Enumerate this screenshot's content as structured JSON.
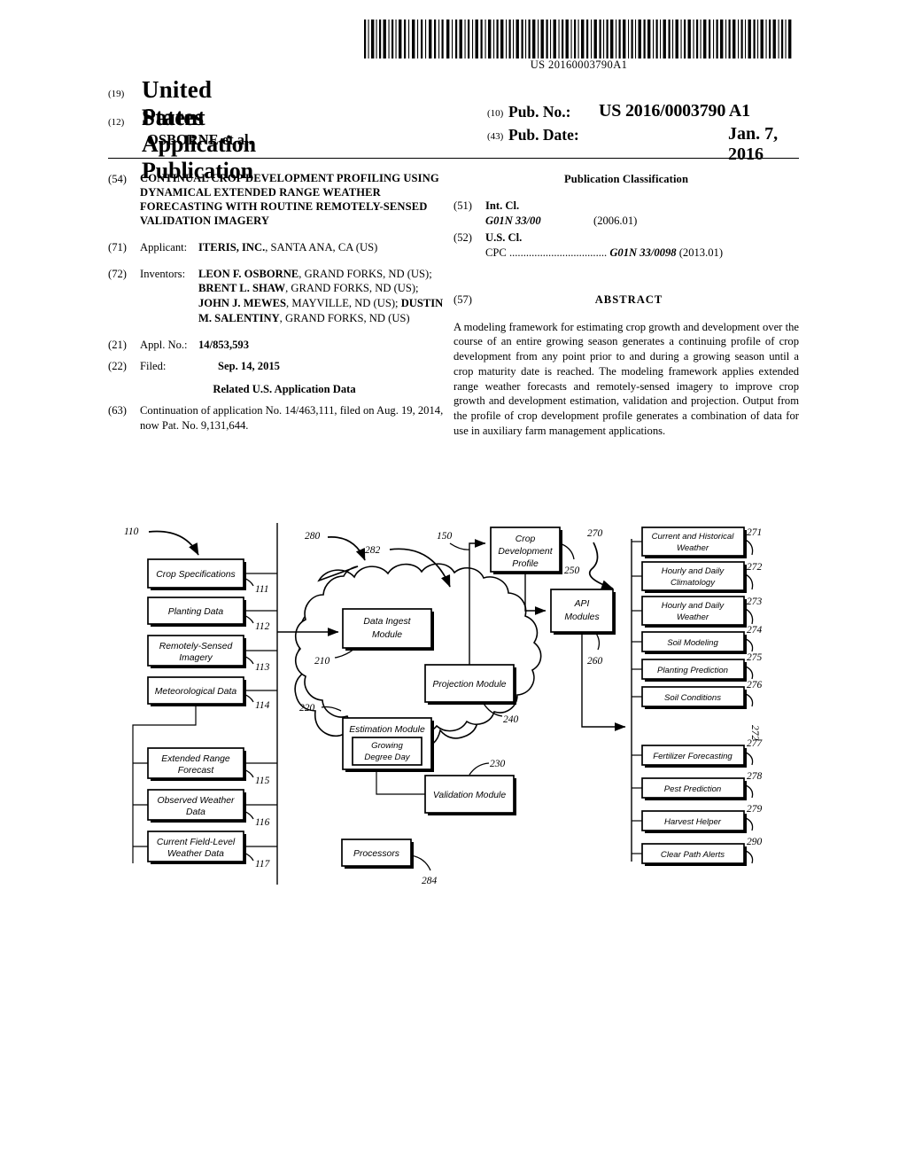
{
  "barcode": {
    "number": "US 20160003790A1"
  },
  "masthead": {
    "country_code": "(19)",
    "country": "United States",
    "doc_type_code": "(12)",
    "doc_type": "Patent Application Publication",
    "authors": "OSBORNE et al.",
    "pub_no_code": "(10)",
    "pub_no_label": "Pub. No.:",
    "pub_no_value": "US 2016/0003790 A1",
    "pub_date_code": "(43)",
    "pub_date_label": "Pub. Date:",
    "pub_date_value": "Jan. 7, 2016"
  },
  "left_column": {
    "title_code": "(54)",
    "title": "CONTINUAL CROP DEVELOPMENT PROFILING USING DYNAMICAL EXTENDED RANGE WEATHER FORECASTING WITH ROUTINE REMOTELY-SENSED VALIDATION IMAGERY",
    "applicant_code": "(71)",
    "applicant_label": "Applicant:",
    "applicant_name": "ITERIS, INC.",
    "applicant_address": ", SANTA ANA, CA (US)",
    "inventors_code": "(72)",
    "inventors_label": "Inventors:",
    "inventors": [
      {
        "name": "LEON F. OSBORNE",
        "address": ", GRAND FORKS, ND (US); "
      },
      {
        "name": "BRENT L. SHAW",
        "address": ", GRAND FORKS, ND (US); "
      },
      {
        "name": "JOHN J. MEWES",
        "address": ", MAYVILLE, ND (US); "
      },
      {
        "name": "DUSTIN M. SALENTINY",
        "address": ", GRAND FORKS, ND (US)"
      }
    ],
    "appl_no_code": "(21)",
    "appl_no_label": "Appl. No.:",
    "appl_no_value": "14/853,593",
    "filed_code": "(22)",
    "filed_label": "Filed:",
    "filed_value": "Sep. 14, 2015",
    "related_header": "Related U.S. Application Data",
    "continuation_code": "(63)",
    "continuation_text": "Continuation of application No. 14/463,111, filed on Aug. 19, 2014, now Pat. No. 9,131,644."
  },
  "right_column": {
    "pub_class_header": "Publication Classification",
    "int_cl_code": "(51)",
    "int_cl_label": "Int. Cl.",
    "int_cl_symbol": "G01N 33/00",
    "int_cl_version": "(2006.01)",
    "us_cl_code": "(52)",
    "us_cl_label": "U.S. Cl.",
    "cpc_label": "CPC",
    "cpc_dots": "...................................",
    "cpc_symbol": "G01N 33/0098",
    "cpc_version": "(2013.01)",
    "abstract_code": "(57)",
    "abstract_header": "ABSTRACT",
    "abstract_text": "A modeling framework for estimating crop growth and development over the course of an entire growing season generates a continuing profile of crop development from any point prior to and during a growing season until a crop maturity date is reached. The modeling framework applies extended range weather forecasts and remotely-sensed imagery to improve crop growth and development estimation, validation and projection. Output from the profile of crop development profile generates a combination of data for use in auxiliary farm management applications."
  },
  "figure": {
    "inputs_group_ref": "110",
    "input_boxes": [
      {
        "label": "Crop Specifications",
        "ref": "111"
      },
      {
        "label": "Planting Data",
        "ref": "112"
      },
      {
        "label": "Remotely-Sensed Imagery",
        "ref": "113"
      },
      {
        "label": "Meteorological Data",
        "ref": "114"
      },
      {
        "label": "Extended Range Forecast",
        "ref": "115"
      },
      {
        "label": "Observed Weather Data",
        "ref": "116"
      },
      {
        "label": "Current Field-Level Weather Data",
        "ref": "117"
      }
    ],
    "cloud_ref": "280",
    "cloud_inner_ref": "282",
    "modules": [
      {
        "label": "Data Ingest Module",
        "ref": "210"
      },
      {
        "label": "Estimation Module",
        "ref": "220"
      },
      {
        "label": "Growing Degree Day",
        "ref": ""
      },
      {
        "label": "Validation Module",
        "ref": "230"
      },
      {
        "label": "Projection Module",
        "ref": "240"
      },
      {
        "label": "Processors",
        "ref": "284"
      }
    ],
    "profile_box": {
      "label": "Crop Development Profile",
      "ref": "250",
      "in_ref": "150"
    },
    "api_box": {
      "label": "API Modules",
      "ref": "260"
    },
    "outputs_group_ref": "270",
    "outputs_side_ref": "272",
    "output_boxes": [
      {
        "label": "Current and Historical Weather",
        "ref": "271"
      },
      {
        "label": "Hourly and Daily Climatology",
        "ref": "272"
      },
      {
        "label": "Hourly and Daily Weather",
        "ref": "273"
      },
      {
        "label": "Soil Modeling",
        "ref": "274"
      },
      {
        "label": "Planting Prediction",
        "ref": "275"
      },
      {
        "label": "Soil Conditions",
        "ref": "276"
      },
      {
        "label": "Fertilizer Forecasting",
        "ref": "277"
      },
      {
        "label": "Pest Prediction",
        "ref": "278"
      },
      {
        "label": "Harvest Helper",
        "ref": "279"
      },
      {
        "label": "Clear Path Alerts",
        "ref": "290"
      }
    ]
  }
}
